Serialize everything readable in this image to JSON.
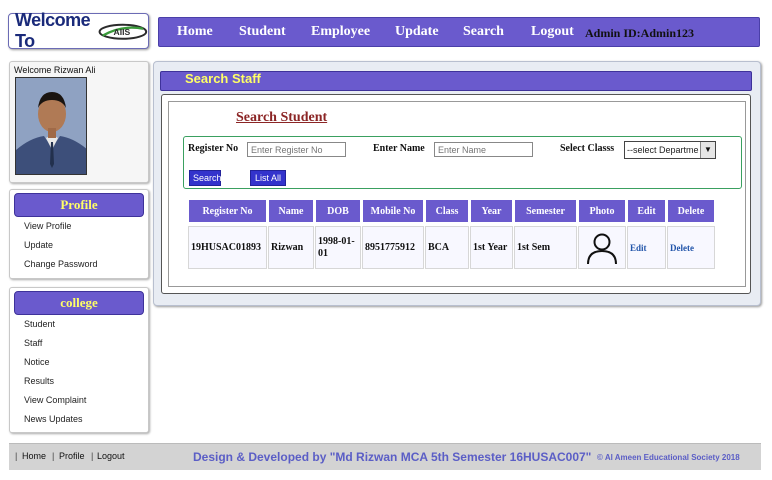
{
  "header": {
    "logo_text": "Welcome To",
    "logo_mark": "AIIS"
  },
  "nav": {
    "items": [
      "Home",
      "Student",
      "Employee",
      "Update",
      "Search",
      "Logout"
    ],
    "admin_id": "Admin ID:Admin123"
  },
  "sidebar": {
    "welcome": "Welcome Rizwan Ali",
    "profile_header": "Profile",
    "profile_items": [
      "View Profile",
      "Update",
      "Change Password"
    ],
    "college_header": "college",
    "college_items": [
      "Student",
      "Staff",
      "Notice",
      "Results",
      "View Complaint",
      "News Updates"
    ]
  },
  "main": {
    "title": "Search Staff",
    "heading": "Search Student",
    "form": {
      "register_label": "Register No",
      "register_placeholder": "Enter Register No",
      "name_label": "Enter Name",
      "name_placeholder": "Enter Name",
      "class_label": "Select Classs",
      "class_selected": "--select Departme",
      "search_button": "Search",
      "list_all_button": "List All"
    },
    "table": {
      "headers": [
        "Register No",
        "Name",
        "DOB",
        "Mobile No",
        "Class",
        "Year",
        "Semester",
        "Photo",
        "Edit",
        "Delete"
      ],
      "rows": [
        {
          "register_no": "19HUSAC01893",
          "name": "Rizwan",
          "dob": "1998-01-01",
          "mobile": "8951775912",
          "class": "BCA",
          "year": "1st Year",
          "semester": "1st Sem",
          "photo_icon": "user-icon",
          "edit": "Edit",
          "delete": "Delete"
        }
      ]
    }
  },
  "footer": {
    "links": [
      "Home",
      "Profile",
      "Logout"
    ],
    "credit": "Design & Developed by \"Md Rizwan MCA 5th Semester 16HUSAC007\"",
    "copyright": "© Al Ameen Educational Society 2018"
  },
  "colors": {
    "accent": "#6a5acd",
    "header_text": "#ffff66",
    "footer_text": "#5b5ec6"
  }
}
